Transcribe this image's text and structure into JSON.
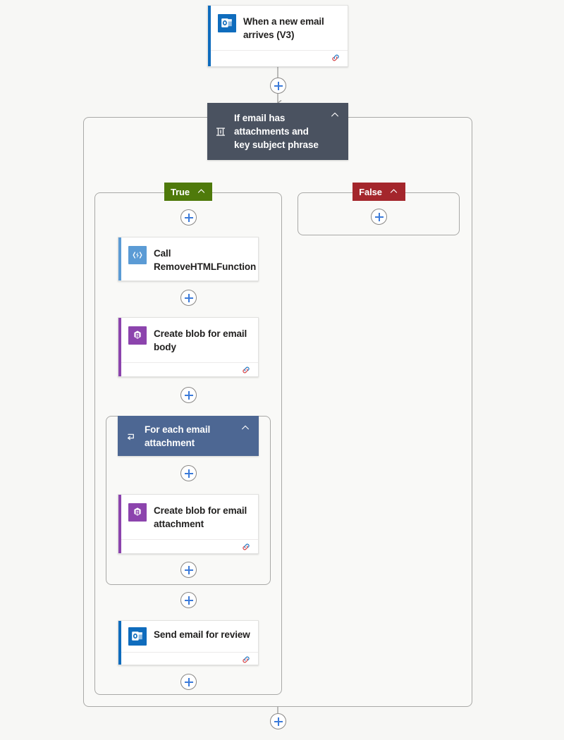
{
  "canvas": {
    "background": "#f7f7f5",
    "connector_color": "#9a9a98"
  },
  "palette": {
    "outlook_blue": "#0f6cbd",
    "azure_function_blue": "#5b9bd5",
    "blob_purple": "#8c44ad",
    "condition_header": "#4a5260",
    "foreach_header": "#4d6793",
    "true_green": "#4f7a0b",
    "false_red": "#a4262c",
    "plus_blue": "#3b7ad9",
    "card_white": "#ffffff",
    "scope_fill": "#f9f9f7",
    "scope_border": "#a9a9a7"
  },
  "nodes": {
    "trigger": {
      "title": "When a new email arrives (V3)",
      "icon": "outlook-icon",
      "accent": "#0f6cbd",
      "has_footer": true,
      "footer_icon": "connection-link-icon"
    },
    "condition": {
      "title": "If email has attachments and key subject phrase",
      "icon": "condition-icon",
      "background": "#4a5260",
      "chevron": "chevron-up-icon"
    },
    "branch_true": {
      "label": "True",
      "background": "#4f7a0b",
      "chevron": "chevron-up-icon"
    },
    "branch_false": {
      "label": "False",
      "background": "#a4262c",
      "chevron": "chevron-up-icon"
    },
    "call_function": {
      "title": "Call RemoveHTMLFunction",
      "icon": "azure-function-icon",
      "accent": "#5b9bd5",
      "has_footer": false
    },
    "blob_body": {
      "title": "Create blob for email body",
      "icon": "blob-storage-icon",
      "accent": "#8c44ad",
      "has_footer": true,
      "footer_icon": "connection-link-icon"
    },
    "foreach": {
      "title": "For each email attachment",
      "icon": "loop-icon",
      "background": "#4d6793",
      "chevron": "chevron-up-icon"
    },
    "blob_attachment": {
      "title": "Create blob for email attachment",
      "icon": "blob-storage-icon",
      "accent": "#8c44ad",
      "has_footer": true,
      "footer_icon": "connection-link-icon"
    },
    "send_email": {
      "title": "Send email for review",
      "icon": "outlook-icon",
      "accent": "#0f6cbd",
      "has_footer": true,
      "footer_icon": "connection-link-icon"
    }
  },
  "add_buttons": [
    {
      "id": "add-after-trigger"
    },
    {
      "id": "add-true-branch-top"
    },
    {
      "id": "add-false-branch"
    },
    {
      "id": "add-after-call-function"
    },
    {
      "id": "add-after-blob-body"
    },
    {
      "id": "add-foreach-top"
    },
    {
      "id": "add-foreach-bottom"
    },
    {
      "id": "add-after-foreach"
    },
    {
      "id": "add-true-branch-bottom"
    },
    {
      "id": "add-after-condition"
    }
  ]
}
